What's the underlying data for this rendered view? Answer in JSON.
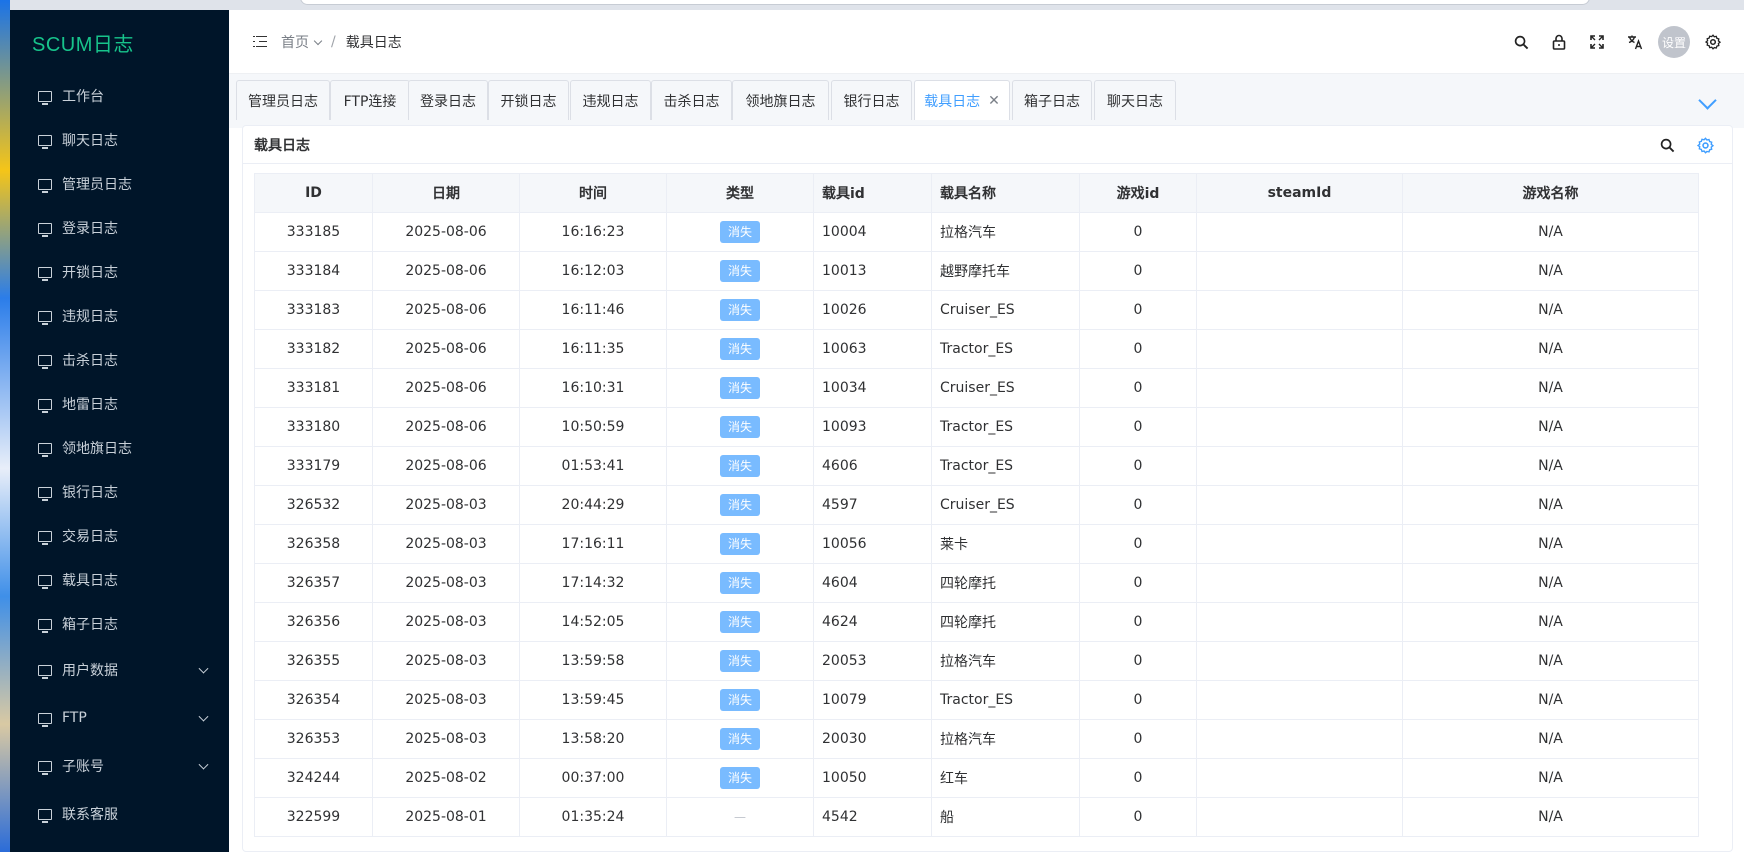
{
  "logo": "SCUM日志",
  "sidebar": {
    "items": [
      {
        "label": "工作台",
        "name": "sidebar-item-workbench",
        "expandable": false
      },
      {
        "label": "聊天日志",
        "name": "sidebar-item-chat-log",
        "expandable": false
      },
      {
        "label": "管理员日志",
        "name": "sidebar-item-admin-log",
        "expandable": false
      },
      {
        "label": "登录日志",
        "name": "sidebar-item-login-log",
        "expandable": false
      },
      {
        "label": "开锁日志",
        "name": "sidebar-item-unlock-log",
        "expandable": false
      },
      {
        "label": "违规日志",
        "name": "sidebar-item-violation-log",
        "expandable": false
      },
      {
        "label": "击杀日志",
        "name": "sidebar-item-kill-log",
        "expandable": false
      },
      {
        "label": "地雷日志",
        "name": "sidebar-item-mine-log",
        "expandable": false
      },
      {
        "label": "领地旗日志",
        "name": "sidebar-item-flag-log",
        "expandable": false
      },
      {
        "label": "银行日志",
        "name": "sidebar-item-bank-log",
        "expandable": false
      },
      {
        "label": "交易日志",
        "name": "sidebar-item-trade-log",
        "expandable": false
      },
      {
        "label": "载具日志",
        "name": "sidebar-item-vehicle-log",
        "expandable": false
      },
      {
        "label": "箱子日志",
        "name": "sidebar-item-chest-log",
        "expandable": false
      },
      {
        "label": "用户数据",
        "name": "sidebar-item-user-data",
        "expandable": true
      },
      {
        "label": "FTP",
        "name": "sidebar-item-ftp",
        "expandable": true
      },
      {
        "label": "子账号",
        "name": "sidebar-item-sub-accounts",
        "expandable": true
      },
      {
        "label": "联系客服",
        "name": "sidebar-item-contact-support",
        "expandable": false
      }
    ]
  },
  "header": {
    "breadcrumb_home": "首页",
    "breadcrumb_sep": "/",
    "breadcrumb_current": "载具日志",
    "avatar_label": "设置",
    "icons": [
      "search-icon",
      "lock-icon",
      "fullscreen-icon",
      "translate-icon",
      "settings-gear-icon"
    ]
  },
  "tabs": [
    {
      "label": "管理员日志",
      "active": false
    },
    {
      "label": "FTP连接",
      "active": false
    },
    {
      "label": "登录日志",
      "active": false
    },
    {
      "label": "开锁日志",
      "active": false
    },
    {
      "label": "违规日志",
      "active": false
    },
    {
      "label": "击杀日志",
      "active": false
    },
    {
      "label": "领地旗日志",
      "active": false
    },
    {
      "label": "银行日志",
      "active": false
    },
    {
      "label": "载具日志",
      "active": true,
      "closable": true
    },
    {
      "label": "箱子日志",
      "active": false
    },
    {
      "label": "聊天日志",
      "active": false
    }
  ],
  "card": {
    "title": "载具日志"
  },
  "table": {
    "columns": [
      "ID",
      "日期",
      "时间",
      "类型",
      "载具id",
      "载具名称",
      "游戏id",
      "steamId",
      "游戏名称"
    ],
    "rows": [
      [
        "333185",
        "2025-08-06",
        "16:16:23",
        "消失",
        "10004",
        "拉格汽车",
        "0",
        "",
        "N/A"
      ],
      [
        "333184",
        "2025-08-06",
        "16:12:03",
        "消失",
        "10013",
        "越野摩托车",
        "0",
        "",
        "N/A"
      ],
      [
        "333183",
        "2025-08-06",
        "16:11:46",
        "消失",
        "10026",
        "Cruiser_ES",
        "0",
        "",
        "N/A"
      ],
      [
        "333182",
        "2025-08-06",
        "16:11:35",
        "消失",
        "10063",
        "Tractor_ES",
        "0",
        "",
        "N/A"
      ],
      [
        "333181",
        "2025-08-06",
        "16:10:31",
        "消失",
        "10034",
        "Cruiser_ES",
        "0",
        "",
        "N/A"
      ],
      [
        "333180",
        "2025-08-06",
        "10:50:59",
        "消失",
        "10093",
        "Tractor_ES",
        "0",
        "",
        "N/A"
      ],
      [
        "333179",
        "2025-08-06",
        "01:53:41",
        "消失",
        "4606",
        "Tractor_ES",
        "0",
        "",
        "N/A"
      ],
      [
        "326532",
        "2025-08-03",
        "20:44:29",
        "消失",
        "4597",
        "Cruiser_ES",
        "0",
        "",
        "N/A"
      ],
      [
        "326358",
        "2025-08-03",
        "17:16:11",
        "消失",
        "10056",
        "莱卡",
        "0",
        "",
        "N/A"
      ],
      [
        "326357",
        "2025-08-03",
        "17:14:32",
        "消失",
        "4604",
        "四轮摩托",
        "0",
        "",
        "N/A"
      ],
      [
        "326356",
        "2025-08-03",
        "14:52:05",
        "消失",
        "4624",
        "四轮摩托",
        "0",
        "",
        "N/A"
      ],
      [
        "326355",
        "2025-08-03",
        "13:59:58",
        "消失",
        "20053",
        "拉格汽车",
        "0",
        "",
        "N/A"
      ],
      [
        "326354",
        "2025-08-03",
        "13:59:45",
        "消失",
        "10079",
        "Tractor_ES",
        "0",
        "",
        "N/A"
      ],
      [
        "326353",
        "2025-08-03",
        "13:58:20",
        "消失",
        "20030",
        "拉格汽车",
        "0",
        "",
        "N/A"
      ],
      [
        "324244",
        "2025-08-02",
        "00:37:00",
        "消失",
        "10050",
        "红车",
        "0",
        "",
        "N/A"
      ],
      [
        "322599",
        "2025-08-01",
        "01:35:24",
        "",
        "4542",
        "船",
        "0",
        "",
        "N/A"
      ]
    ]
  },
  "colors": {
    "sidebar_bg": "#001529",
    "logo": "#17c48b",
    "accent": "#409eff",
    "tag_bg": "#79bbff"
  }
}
